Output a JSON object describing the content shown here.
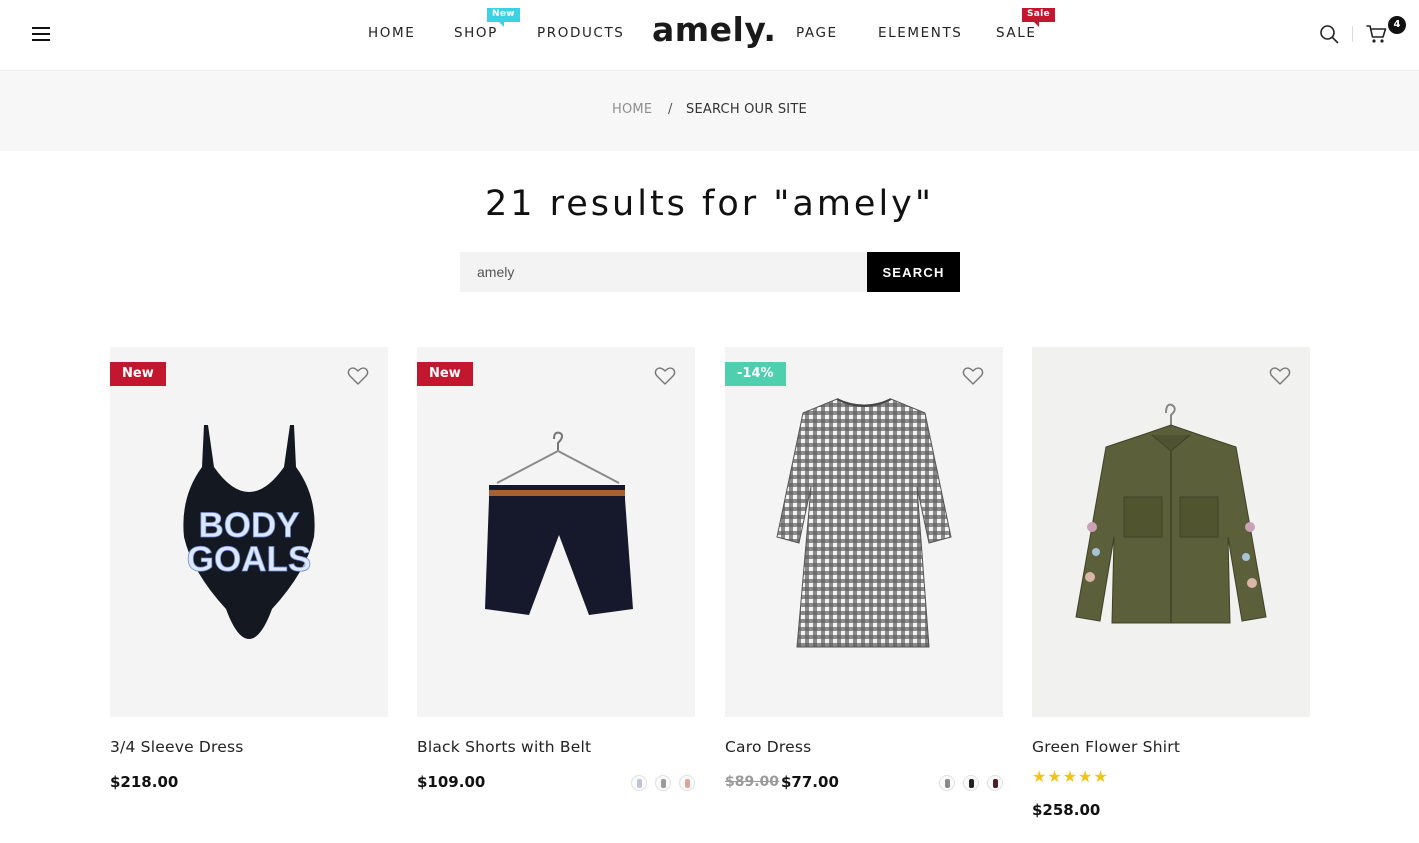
{
  "header": {
    "logo": "amely.",
    "nav": [
      {
        "label": "HOME"
      },
      {
        "label": "SHOP",
        "badge": "New"
      },
      {
        "label": "PRODUCTS"
      },
      {
        "label": "PAGE"
      },
      {
        "label": "ELEMENTS"
      },
      {
        "label": "SALE",
        "badge": "Sale"
      }
    ],
    "cart_count": "4",
    "icons": [
      "menu-icon",
      "search-icon",
      "cart-icon"
    ]
  },
  "breadcrumb": {
    "home": "HOME",
    "separator": "/",
    "current": "SEARCH OUR SITE"
  },
  "search": {
    "title": "21 results for \"amely\"",
    "value": "amely",
    "button": "SEARCH"
  },
  "products": [
    {
      "name": "3/4 Sleeve Dress",
      "price": "$218.00",
      "tag": "New"
    },
    {
      "name": "Black Shorts with Belt",
      "price": "$109.00",
      "tag": "New",
      "swatches": 3
    },
    {
      "name": "Caro Dress",
      "old_price": "$89.00",
      "price": "$77.00",
      "tag": "-14%",
      "swatches": 3
    },
    {
      "name": "Green Flower Shirt",
      "price": "$258.00",
      "rating": 5,
      "stars": "★★★★★"
    }
  ],
  "colors": {
    "badge_new": "#3bd3e4",
    "badge_sale": "#c3172f",
    "tag_new": "#c3172f",
    "tag_discount": "#4fcfae",
    "star": "#f0c419"
  }
}
